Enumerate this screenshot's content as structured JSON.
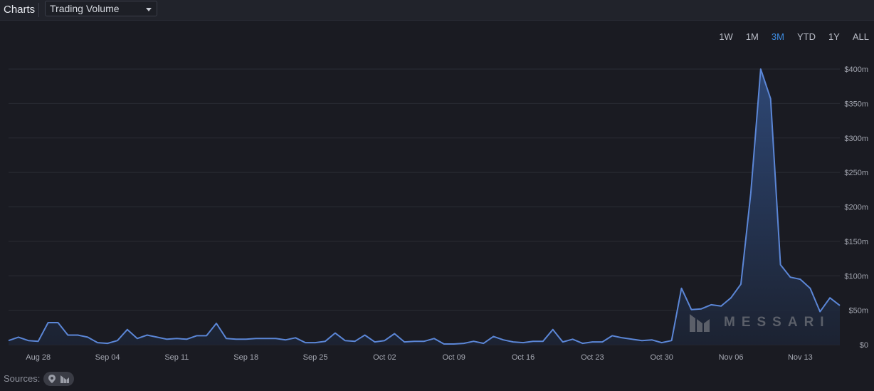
{
  "header": {
    "title": "Charts",
    "metric_select": "Trading Volume"
  },
  "ranges": [
    "1W",
    "1M",
    "3M",
    "YTD",
    "1Y",
    "ALL"
  ],
  "active_range": "3M",
  "footer": {
    "sources_label": "Sources:"
  },
  "watermark": "MESSARI",
  "colors": {
    "line": "#5b86d6",
    "area_top": "#2f4a7a",
    "area_bottom": "#1c2333",
    "grid": "#2a2c35",
    "active_range": "#3d8be0"
  },
  "chart_data": {
    "type": "area",
    "title": "",
    "xlabel": "",
    "ylabel": "",
    "ylim": [
      0,
      400
    ],
    "y_unit": "$m",
    "y_ticks": [
      0,
      50,
      100,
      150,
      200,
      250,
      300,
      350,
      400
    ],
    "y_tick_labels": [
      "$0",
      "$50m",
      "$100m",
      "$150m",
      "$200m",
      "$250m",
      "$300m",
      "$350m",
      "$400m"
    ],
    "x_ticks": [
      "Aug 28",
      "Sep 04",
      "Sep 11",
      "Sep 18",
      "Sep 25",
      "Oct 02",
      "Oct 09",
      "Oct 16",
      "Oct 23",
      "Oct 30",
      "Nov 06",
      "Nov 13"
    ],
    "x_start": "Aug 25",
    "x_end": "Nov 16",
    "grid": true,
    "values": [
      6,
      11,
      6,
      5,
      32,
      32,
      14,
      14,
      11,
      3,
      2,
      6,
      22,
      9,
      14,
      11,
      8,
      9,
      8,
      13,
      13,
      31,
      9,
      8,
      8,
      9,
      9,
      9,
      7,
      10,
      3,
      3,
      5,
      17,
      6,
      5,
      14,
      4,
      6,
      16,
      4,
      5,
      5,
      9,
      1,
      1,
      2,
      5,
      2,
      12,
      7,
      4,
      3,
      5,
      5,
      22,
      4,
      8,
      2,
      4,
      4,
      13,
      10,
      8,
      6,
      7,
      3,
      6,
      82,
      51,
      52,
      58,
      56,
      68,
      88,
      220,
      400,
      357,
      116,
      98,
      95,
      82,
      48,
      68,
      57
    ]
  }
}
